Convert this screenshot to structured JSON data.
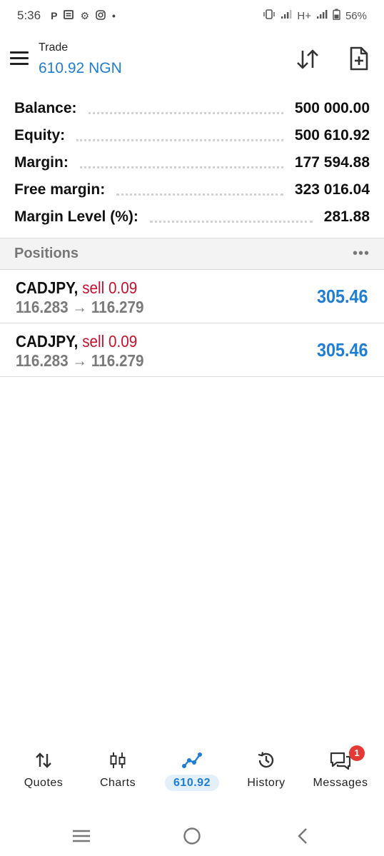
{
  "status_bar": {
    "time": "5:36",
    "icons": [
      "parking-icon",
      "news-icon",
      "settings-icon",
      "instagram-icon",
      "dot-icon"
    ],
    "network": "H+",
    "battery": "56%"
  },
  "header": {
    "title": "Trade",
    "subtitle": "610.92 NGN"
  },
  "summary": [
    {
      "label": "Balance:",
      "value": "500 000.00"
    },
    {
      "label": "Equity:",
      "value": "500 610.92"
    },
    {
      "label": "Margin:",
      "value": "177 594.88"
    },
    {
      "label": "Free margin:",
      "value": "323 016.04"
    },
    {
      "label": "Margin Level (%):",
      "value": "281.88"
    }
  ],
  "positions": {
    "title": "Positions",
    "more": "•••",
    "items": [
      {
        "symbol": "CADJPY,",
        "side": "sell 0.09",
        "prices": "116.283 → 116.279",
        "profit": "305.46"
      },
      {
        "symbol": "CADJPY,",
        "side": "sell 0.09",
        "prices": "116.283 → 116.279",
        "profit": "305.46"
      }
    ]
  },
  "bottom_nav": {
    "quotes": "Quotes",
    "charts": "Charts",
    "trade": "610.92",
    "history": "History",
    "messages": "Messages",
    "messages_badge": "1"
  },
  "colors": {
    "accent": "#1e7dd4",
    "sell": "#c8102e",
    "badge": "#e53935"
  }
}
